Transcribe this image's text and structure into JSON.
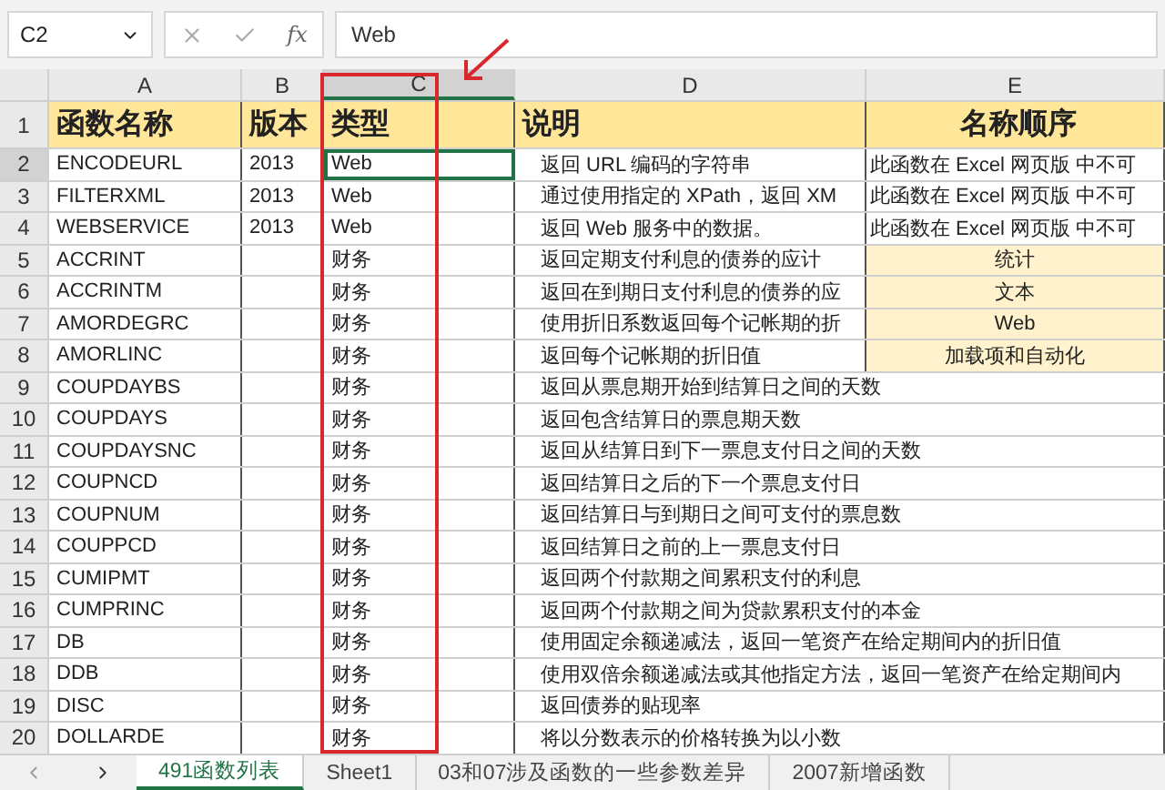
{
  "formula_bar": {
    "name_box": "C2",
    "function_label": "fx",
    "formula": "Web"
  },
  "columns": [
    {
      "label": "A",
      "selected": false
    },
    {
      "label": "B",
      "selected": false
    },
    {
      "label": "C",
      "selected": true
    },
    {
      "label": "D",
      "selected": false
    },
    {
      "label": "E",
      "selected": false
    }
  ],
  "header_row": {
    "number": "1",
    "cells": [
      "函数名称",
      "版本",
      "类型",
      "说明",
      "名称顺序"
    ]
  },
  "rows": [
    {
      "number": "2",
      "selected": true,
      "name": "ENCODEURL",
      "version": "2013",
      "type": "Web",
      "description": "返回 URL 编码的字符串",
      "order": {
        "text": "此函数在 Excel 网页版 中不可",
        "highlighted": false
      }
    },
    {
      "number": "3",
      "selected": false,
      "name": "FILTERXML",
      "version": "2013",
      "type": "Web",
      "description": "通过使用指定的 XPath，返回 XM",
      "order": {
        "text": "此函数在 Excel 网页版 中不可",
        "highlighted": false
      }
    },
    {
      "number": "4",
      "selected": false,
      "name": "WEBSERVICE",
      "version": "2013",
      "type": "Web",
      "description": "返回 Web 服务中的数据。",
      "order": {
        "text": "此函数在 Excel 网页版 中不可",
        "highlighted": false
      }
    },
    {
      "number": "5",
      "selected": false,
      "name": "ACCRINT",
      "version": "",
      "type": "财务",
      "description": "返回定期支付利息的债券的应计",
      "order": {
        "text": "统计",
        "highlighted": true
      }
    },
    {
      "number": "6",
      "selected": false,
      "name": "ACCRINTM",
      "version": "",
      "type": "财务",
      "description": "返回在到期日支付利息的债券的应",
      "order": {
        "text": "文本",
        "highlighted": true
      }
    },
    {
      "number": "7",
      "selected": false,
      "name": "AMORDEGRC",
      "version": "",
      "type": "财务",
      "description": "使用折旧系数返回每个记帐期的折",
      "order": {
        "text": "Web",
        "highlighted": true
      }
    },
    {
      "number": "8",
      "selected": false,
      "name": "AMORLINC",
      "version": "",
      "type": "财务",
      "description": "返回每个记帐期的折旧值",
      "order": {
        "text": "加载项和自动化",
        "highlighted": true
      }
    },
    {
      "number": "9",
      "selected": false,
      "name": "COUPDAYBS",
      "version": "",
      "type": "财务",
      "description": "返回从票息期开始到结算日之间的天数"
    },
    {
      "number": "10",
      "selected": false,
      "name": "COUPDAYS",
      "version": "",
      "type": "财务",
      "description": "返回包含结算日的票息期天数"
    },
    {
      "number": "11",
      "selected": false,
      "name": "COUPDAYSNC",
      "version": "",
      "type": "财务",
      "description": "返回从结算日到下一票息支付日之间的天数"
    },
    {
      "number": "12",
      "selected": false,
      "name": "COUPNCD",
      "version": "",
      "type": "财务",
      "description": "返回结算日之后的下一个票息支付日"
    },
    {
      "number": "13",
      "selected": false,
      "name": "COUPNUM",
      "version": "",
      "type": "财务",
      "description": "返回结算日与到期日之间可支付的票息数"
    },
    {
      "number": "14",
      "selected": false,
      "name": "COUPPCD",
      "version": "",
      "type": "财务",
      "description": "返回结算日之前的上一票息支付日"
    },
    {
      "number": "15",
      "selected": false,
      "name": "CUMIPMT",
      "version": "",
      "type": "财务",
      "description": "返回两个付款期之间累积支付的利息"
    },
    {
      "number": "16",
      "selected": false,
      "name": "CUMPRINC",
      "version": "",
      "type": "财务",
      "description": "返回两个付款期之间为贷款累积支付的本金"
    },
    {
      "number": "17",
      "selected": false,
      "name": "DB",
      "version": "",
      "type": "财务",
      "description": "使用固定余额递减法，返回一笔资产在给定期间内的折旧值"
    },
    {
      "number": "18",
      "selected": false,
      "name": "DDB",
      "version": "",
      "type": "财务",
      "description": "使用双倍余额递减法或其他指定方法，返回一笔资产在给定期间内"
    },
    {
      "number": "19",
      "selected": false,
      "name": "DISC",
      "version": "",
      "type": "财务",
      "description": "返回债券的贴现率"
    },
    {
      "number": "20",
      "selected": false,
      "name": "DOLLARDE",
      "version": "",
      "type": "财务",
      "description": "将以分数表示的价格转换为以小数"
    }
  ],
  "sheet_tabs": [
    {
      "label": "491函数列表",
      "selected": true
    },
    {
      "label": "Sheet1",
      "selected": false
    },
    {
      "label": "03和07涉及函数的一些参数差异",
      "selected": false
    },
    {
      "label": "2007新增函数",
      "selected": false
    }
  ]
}
